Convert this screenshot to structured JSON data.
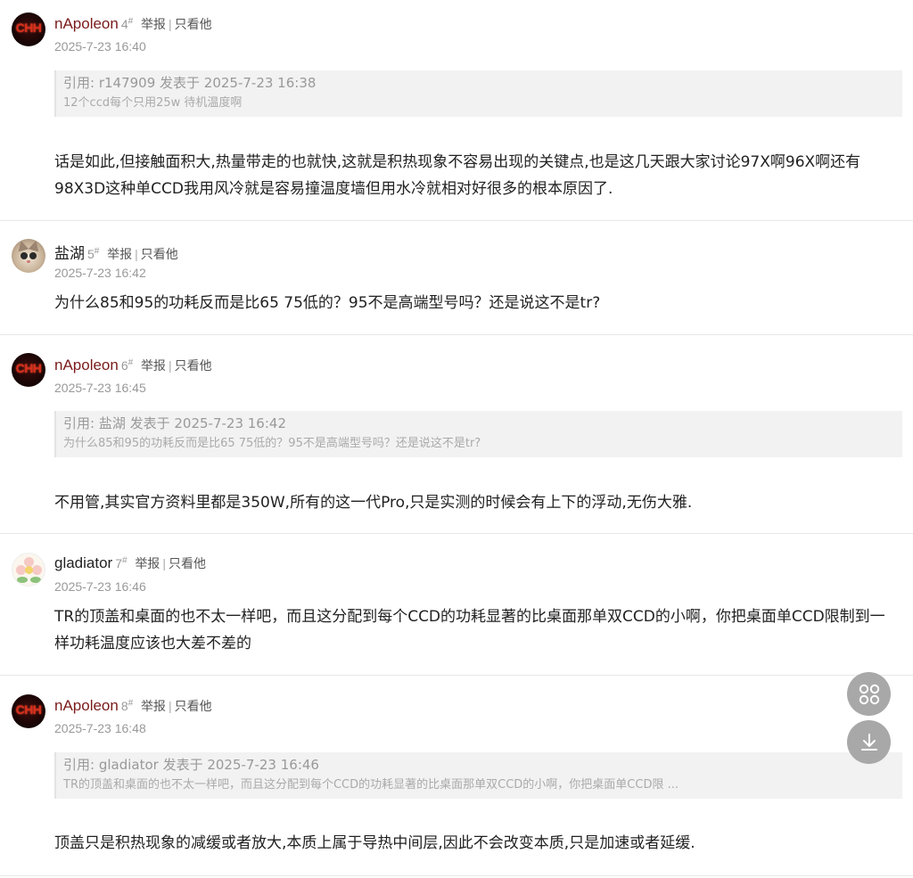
{
  "posts": [
    {
      "username": "nApoleon",
      "floor": "4",
      "floor_mark": "#",
      "report_label": "举报",
      "separator": "|",
      "only_label": "只看他",
      "time": "2025-7-23 16:40",
      "quote_header": "引用: r147909 发表于 2025-7-23 16:38",
      "quote_body": "12个ccd每个只用25w 待机温度啊",
      "content": "话是如此,但接触面积大,热量带走的也就快,这就是积热现象不容易出现的关键点,也是这几天跟大家讨论97X啊96X啊还有98X3D这种单CCD我用风冷就是容易撞温度墙但用水冷就相对好很多的根本原因了."
    },
    {
      "username": "盐湖",
      "floor": "5",
      "floor_mark": "#",
      "report_label": "举报",
      "separator": "|",
      "only_label": "只看他",
      "time": "2025-7-23 16:42",
      "content": "为什么85和95的功耗反而是比65 75低的？95不是高端型号吗？还是说这不是tr?"
    },
    {
      "username": "nApoleon",
      "floor": "6",
      "floor_mark": "#",
      "report_label": "举报",
      "separator": "|",
      "only_label": "只看他",
      "time": "2025-7-23 16:45",
      "quote_header": "引用: 盐湖 发表于 2025-7-23 16:42",
      "quote_body": "为什么85和95的功耗反而是比65 75低的？95不是高端型号吗？还是说这不是tr?",
      "content": "不用管,其实官方资料里都是350W,所有的这一代Pro,只是实测的时候会有上下的浮动,无伤大雅."
    },
    {
      "username": "gladiator",
      "floor": "7",
      "floor_mark": "#",
      "report_label": "举报",
      "separator": "|",
      "only_label": "只看他",
      "time": "2025-7-23 16:46",
      "content": "TR的顶盖和桌面的也不太一样吧，而且这分配到每个CCD的功耗显著的比桌面那单双CCD的小啊，你把桌面单CCD限制到一样功耗温度应该也大差不差的"
    },
    {
      "username": "nApoleon",
      "floor": "8",
      "floor_mark": "#",
      "report_label": "举报",
      "separator": "|",
      "only_label": "只看他",
      "time": "2025-7-23 16:48",
      "quote_header": "引用: gladiator 发表于 2025-7-23 16:46",
      "quote_body": "TR的顶盖和桌面的也不太一样吧，而且这分配到每个CCD的功耗显著的比桌面那单双CCD的小啊，你把桌面单CCD限 ...",
      "content": "顶盖只是积热现象的减缓或者放大,本质上属于导热中间层,因此不会改变本质,只是加速或者延缓."
    }
  ],
  "avatar_text": "CHH",
  "fab": {
    "apps_icon": "apps-grid-icon",
    "download_icon": "download-arrow-icon"
  },
  "colors": {
    "username_accent": "#7a1a1a",
    "meta_gray": "#999999",
    "quote_bg": "#f2f2f2",
    "fab_bg": "#a8a8a8"
  }
}
